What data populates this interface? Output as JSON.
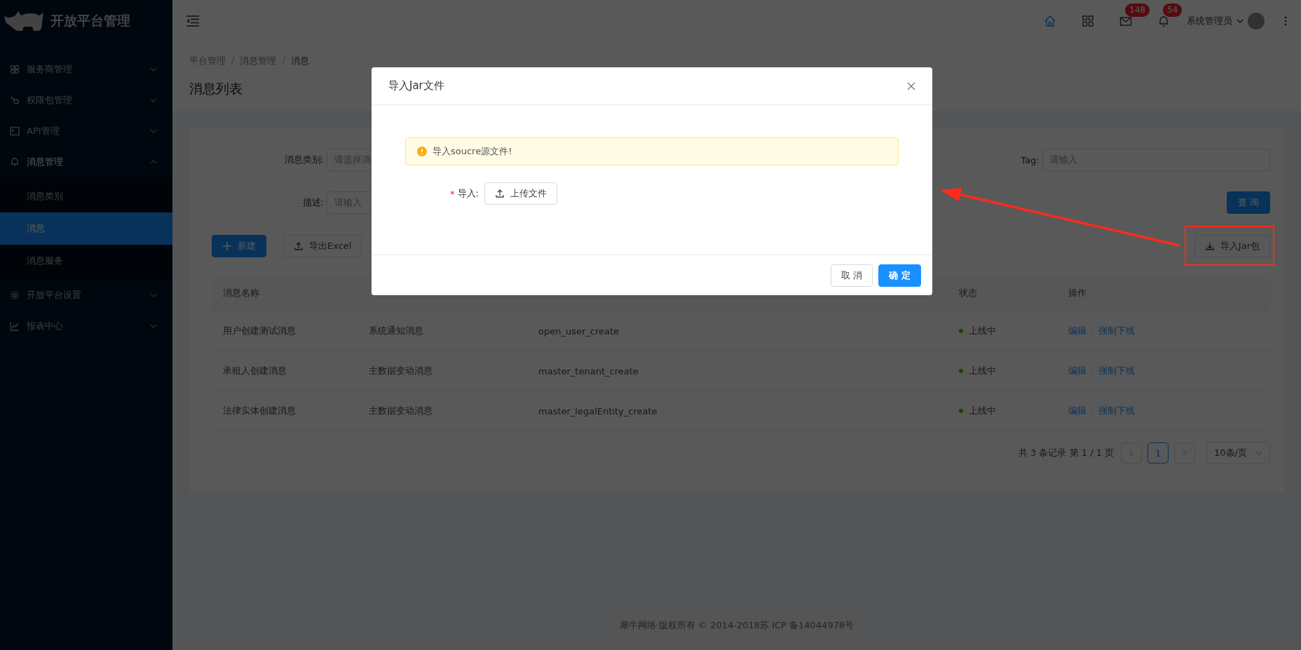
{
  "sidebar": {
    "logo": "开放平台管理",
    "items": [
      {
        "label": "服务商管理",
        "expanded": false
      },
      {
        "label": "权限包管理",
        "expanded": false
      },
      {
        "label": "API管理",
        "expanded": false
      },
      {
        "label": "消息管理",
        "expanded": true,
        "children": [
          {
            "label": "消息类别",
            "selected": false
          },
          {
            "label": "消息",
            "selected": true
          },
          {
            "label": "消息服务",
            "selected": false
          }
        ]
      },
      {
        "label": "开放平台设置",
        "expanded": false
      },
      {
        "label": "报表中心",
        "expanded": false
      }
    ]
  },
  "topbar": {
    "tools": [
      {
        "kind": "home",
        "selected": true
      },
      {
        "kind": "apps",
        "selected": false
      },
      {
        "kind": "mail",
        "selected": false,
        "badge": "148"
      },
      {
        "kind": "bell",
        "selected": false,
        "badge": "54"
      }
    ],
    "user": "系统管理员"
  },
  "breadcrumb": {
    "separator": "/",
    "items": [
      "平台管理",
      "消息管理",
      "消息"
    ]
  },
  "page_title": "消息列表",
  "filters": {
    "category": {
      "label": "消息类别:",
      "placeholder": "请选择消"
    },
    "tag": {
      "label": "Tag:",
      "placeholder": "请输入"
    },
    "description": {
      "label": "描述:",
      "placeholder": "请输入"
    },
    "search_button": "查 询"
  },
  "actions": {
    "new": "新建",
    "export": "导出Excel",
    "import": "导入Jar包"
  },
  "table": {
    "columns": [
      "消息名称",
      "状态",
      "操作"
    ],
    "rows": [
      {
        "name": "用户创建测试消息",
        "category": "系统通知消息",
        "tag": "open_user_create",
        "status": "上线中",
        "actions": [
          "编辑",
          "强制下线"
        ]
      },
      {
        "name": "承租人创建消息",
        "category": "主数据变动消息",
        "tag": "master_tenant_create",
        "status": "上线中",
        "actions": [
          "编辑",
          "强制下线"
        ]
      },
      {
        "name": "法律实体创建消息",
        "category": "主数据变动消息",
        "tag": "master_legalEntity_create",
        "status": "上线中",
        "actions": [
          "编辑",
          "强制下线"
        ]
      }
    ]
  },
  "pagination": {
    "summary": "共 3 条记录 第 1 / 1 页",
    "pages": [
      {
        "label": "1",
        "selected": true
      }
    ],
    "page_size": "10条/页"
  },
  "footer": "犀牛网络·版权所有 © 2014-2018苏 ICP 备14044978号",
  "modal": {
    "title": "导入Jar文件",
    "alert": "导入soucre源文件!",
    "field_label": "导入:",
    "required_mark": "*",
    "upload_button": "上传文件",
    "cancel_button": "取 消",
    "ok_button": "确 定"
  }
}
